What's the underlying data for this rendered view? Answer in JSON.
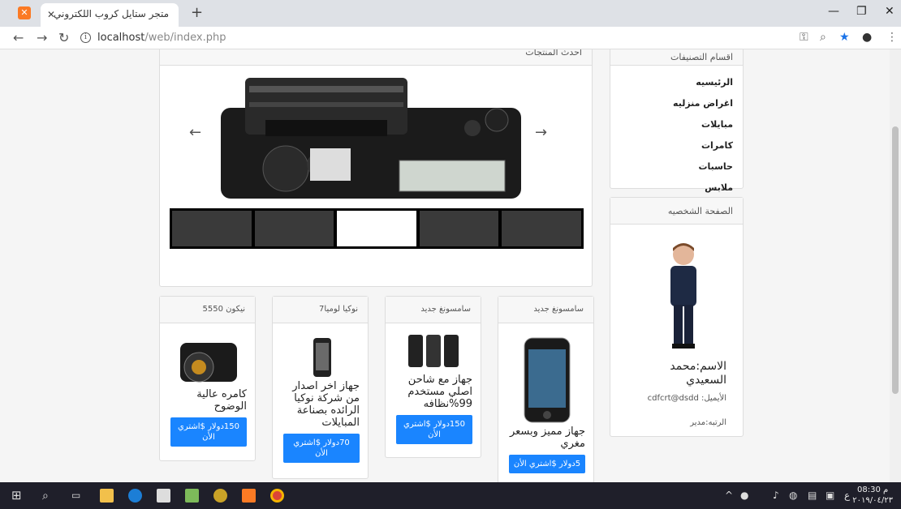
{
  "browser": {
    "tab_title": "متجر ستايل كروب اللكتروني",
    "url_host": "localhost",
    "url_path": "/web/index.php"
  },
  "slider": {
    "header": "احدث المنتجات",
    "prev": "←",
    "next": "→"
  },
  "categories": {
    "header": "اقسام التصنيفات",
    "items": [
      "الرئيسيه",
      "اغراض منزليه",
      "مبايلات",
      "كامرات",
      "حاسبات",
      "ملابس"
    ]
  },
  "profile": {
    "header": "الصفحة الشخصيه",
    "name": "الاسم:محمد السعيدي",
    "email_label": "الأيميل:",
    "email": "cdfcrt@dsdd",
    "role": "الرتبه:مدير"
  },
  "products": [
    {
      "title": "نيكون 5550",
      "desc": "كامره عالية الوضوح",
      "buy": "150دولار $اشتري الأن"
    },
    {
      "title": "نوكيا لوميا7",
      "desc": "جهاز اخر اصدار من شركة نوكيا الرائده بصناعة المبايلات",
      "buy": "70دولار $اشتري الأن"
    },
    {
      "title": "سامسونغ جديد",
      "desc": "جهاز مع شاحن اصلي مستخدم 99%نظافه",
      "buy": "150دولار $اشتري الأن"
    },
    {
      "title": "سامسونغ جديد",
      "desc": "جهاز مميز وبسعر مغري",
      "buy": "5دولار $اشتري الأن"
    }
  ],
  "taskbar": {
    "time": "08:30 م",
    "date": "٢٠١٩/٠٤/٢٣",
    "lang": "ع"
  },
  "colors": {
    "accent": "#1a85ff",
    "taskbar": "#1f1f2a"
  }
}
